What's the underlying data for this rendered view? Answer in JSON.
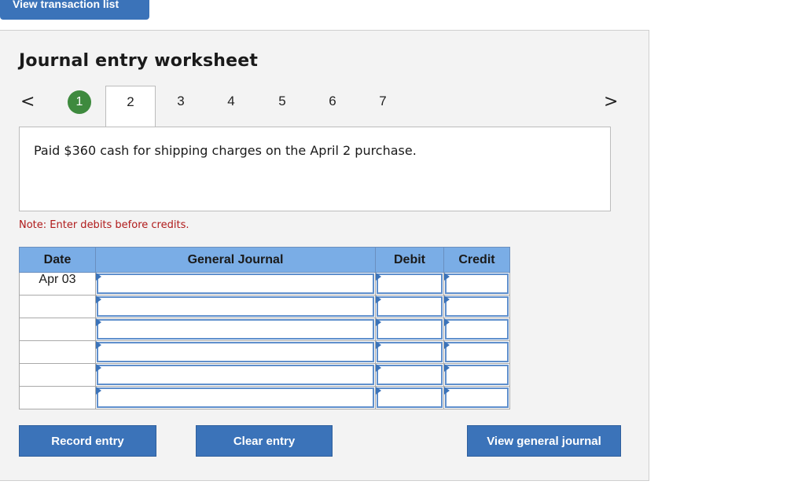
{
  "top": {
    "view_transaction_label": "View transaction list"
  },
  "title": "Journal entry worksheet",
  "nav": {
    "prev": "<",
    "next": ">",
    "tabs": [
      "1",
      "2",
      "3",
      "4",
      "5",
      "6",
      "7"
    ],
    "completed_tab": "1",
    "active_tab": "2"
  },
  "question": "Paid $360 cash for shipping charges on the April 2 purchase.",
  "note": "Note: Enter debits before credits.",
  "table": {
    "headers": {
      "date": "Date",
      "journal": "General Journal",
      "debit": "Debit",
      "credit": "Credit"
    },
    "rows": [
      {
        "date": "Apr 03",
        "journal": "",
        "debit": "",
        "credit": ""
      },
      {
        "date": "",
        "journal": "",
        "debit": "",
        "credit": ""
      },
      {
        "date": "",
        "journal": "",
        "debit": "",
        "credit": ""
      },
      {
        "date": "",
        "journal": "",
        "debit": "",
        "credit": ""
      },
      {
        "date": "",
        "journal": "",
        "debit": "",
        "credit": ""
      },
      {
        "date": "",
        "journal": "",
        "debit": "",
        "credit": ""
      }
    ]
  },
  "buttons": {
    "record": "Record entry",
    "clear": "Clear entry",
    "view_journal": "View general journal"
  },
  "colors": {
    "button_blue": "#3b73b9",
    "header_blue": "#7aade6",
    "done_green": "#3e8a3e",
    "note_red": "#b01a1a"
  }
}
